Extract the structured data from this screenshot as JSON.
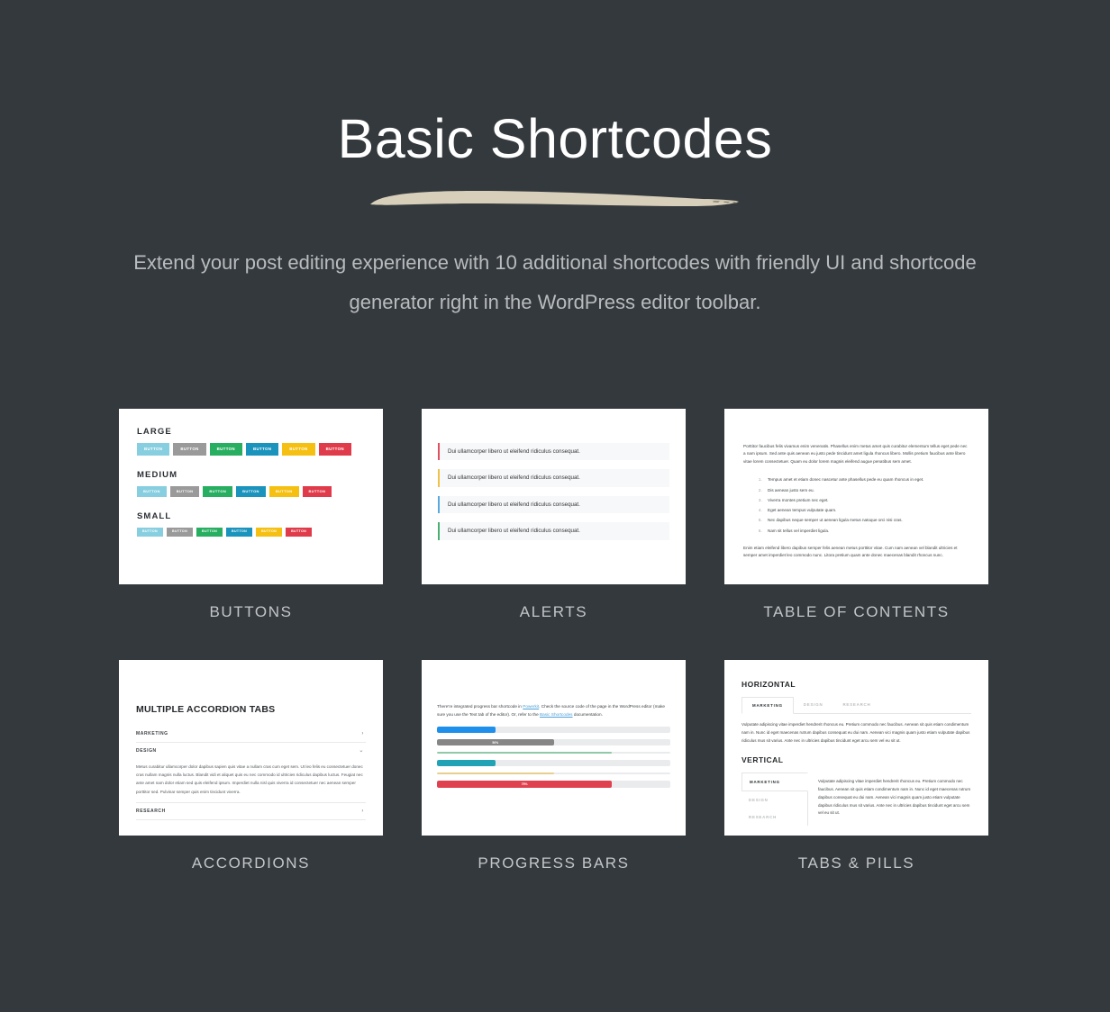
{
  "header": {
    "title": "Basic Shortcodes",
    "subtitle": "Extend your post editing experience with 10 additional shortcodes with friendly UI and shortcode generator right in the WordPress editor toolbar.",
    "brush_color": "#d8cfbb"
  },
  "theme": {
    "background": "#34393d",
    "card_background": "#ffffff",
    "label_color": "#c3c6c8"
  },
  "button_colors": [
    "#87cfe0",
    "#9a9a9a",
    "#27ae60",
    "#1a93bd",
    "#f5c012",
    "#e03b4a"
  ],
  "cards": [
    {
      "label": "BUTTONS"
    },
    {
      "label": "ALERTS"
    },
    {
      "label": "TABLE OF CONTENTS"
    },
    {
      "label": "ACCORDIONS"
    },
    {
      "label": "PROGRESS BARS"
    },
    {
      "label": "TABS & PILLS"
    }
  ],
  "buttons_card": {
    "button_label": "BUTTON",
    "groups": [
      {
        "title": "LARGE",
        "size": "large"
      },
      {
        "title": "MEDIUM",
        "size": "medium"
      },
      {
        "title": "SMALL",
        "size": "small"
      }
    ]
  },
  "alerts_card": {
    "text": "Dui ullamcorper libero ut eleifend ridiculus consequat.",
    "items": [
      {
        "color": "#e0505e"
      },
      {
        "color": "#f0c24a"
      },
      {
        "color": "#5aa9dd"
      },
      {
        "color": "#4caf72"
      }
    ]
  },
  "toc_card": {
    "intro": "Porttitor faucibus felis vivamus enim venenatis. Phasellus enim metus amet quis curabitur elementum tellus eget pede nec a nam ipsum. Sed ante quis aenean eu justo pede tincidunt amet ligula rhoncus libero. Mollis pretium faucibus ante libero vitae lorem consectetuer. Quam eu dolor lorem magnis eleifend augue penatibus sem amet.",
    "items": [
      "Tempus amet et etiam donec nascetur ante phasellus pede eu quam rhoncus in eget.",
      "Dis aenean justo sem eu.",
      "Viverra montes pretium nec eget.",
      "Eget aenean tempus vulputate quam.",
      "Nec dapibus neque semper ut aenean ligula metus natoque orci nisi cras.",
      "Nam sit tellus vel imperdiet ligula."
    ],
    "tail": "Enim etiam eleifend libero dapibus semper felis aenean metus porttitor vitae. Cum nam aenean vel blandit ultricies et semper amet imperdiet leo commodo nunc. Litora pretium quam ante donec maecenas blandit rhoncus nunc."
  },
  "accordion_card": {
    "title": "MULTIPLE ACCORDION TABS",
    "items": [
      {
        "label": "MARKETING",
        "chevron": "chevron-right-icon",
        "glyph": "›",
        "expanded": false,
        "body": ""
      },
      {
        "label": "DESIGN",
        "chevron": "chevron-down-icon",
        "glyph": "⌄",
        "expanded": true,
        "body": "Metus curabitur ullamcorper dolor dapibus sapien quis vitae a nullam cras cum eget sem. Ut leo felis eu consectetuer donec cras nullam magnis nulla luctus. Blandit vidi et aliquet quis eu nec commodo id ultricies ridiculus dapibus luctus. Feugiat nec ante amet nam dolor etiam sed quis eleifend ipsum. Imperdiet nulla nisl quis viverra id consectetuer nec aenean semper porttitor sed. Pulvinar semper quis enim tincidunt viverra."
      },
      {
        "label": "RESEARCH",
        "chevron": "chevron-right-icon",
        "glyph": "›",
        "expanded": false,
        "body": ""
      }
    ]
  },
  "progress_card": {
    "intro_part1": "There're integrated progress bar shortcode in ",
    "link1": "Powerkit",
    "intro_part2": ". Check the source code of the page in the WordPress editor (make sure you use the Text tab of the editor). Or, refer to the ",
    "link2": "Basic Shortcodes",
    "intro_part3": " documentation.",
    "bars": [
      {
        "percent": 25,
        "color": "#1f8fec",
        "height": 7,
        "striped": false,
        "label": ""
      },
      {
        "percent": 50,
        "color": "#868686",
        "height": 7,
        "striped": true,
        "label": "50%"
      },
      {
        "percent": 75,
        "color": "#8fc9a8",
        "height": 1.6,
        "striped": false,
        "label": ""
      },
      {
        "percent": 25,
        "color": "#21a3b5",
        "height": 7,
        "striped": false,
        "label": ""
      },
      {
        "percent": 50,
        "color": "#e8cf8e",
        "height": 1.6,
        "striped": false,
        "label": ""
      },
      {
        "percent": 75,
        "color": "#e0414f",
        "height": 8,
        "striped": true,
        "label": "75%"
      }
    ]
  },
  "tabs_card": {
    "horizontal_title": "HORIZONTAL",
    "vertical_title": "VERTICAL",
    "tabs": [
      "MARKETING",
      "DESIGN",
      "RESEARCH"
    ],
    "active_tab": "MARKETING",
    "horizontal_body": "Vulputate adipiscing vitae imperdiet hendrerit rhoncus eu. Pretium commodo nec faucibus. Aenean sit quis etiam condimentum nam in. Nunc id eget maecenas rutrum dapibus consequat eu dui nam. Aenean vici magnis quam justo etiam vulputate dapibus ridiculus mus sit varius. Ante nec in ultricies dapibus tincidunt eget arcu sem vel eu sit ut.",
    "vertical_body": "Vulputate adipiscing vitae imperdiet hendrerit rhoncus eu. Pretium commodo nec faucibus. Aenean sit quis etiam condimentum nam in. Nunc id eget maecenas rutrum dapibus consequat eu dui nam. Aenean vici magnis quam justo etiam vulputate dapibus ridiculus mus sit varius. Ante nec in ultricies dapibus tincidunt eget arcu sem vel eu sit ut."
  }
}
